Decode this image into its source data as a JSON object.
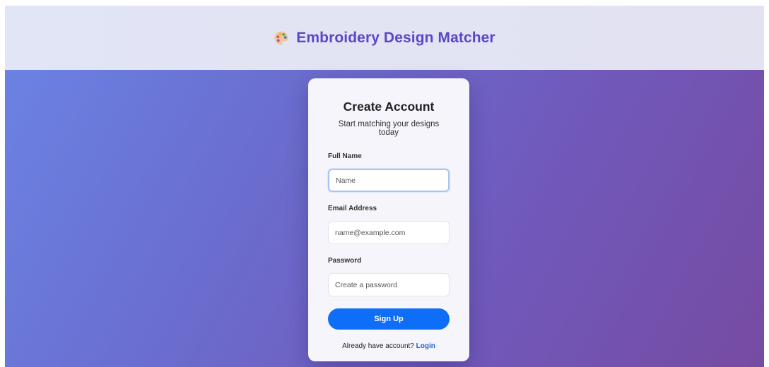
{
  "header": {
    "title": "Embroidery Design Matcher",
    "logo_icon": "artist-palette-icon",
    "title_color": "#5a47c8"
  },
  "card": {
    "title": "Create Account",
    "subtitle": "Start matching your designs today",
    "fields": {
      "full_name": {
        "label": "Full Name",
        "placeholder": "Name",
        "value": "",
        "focused": true
      },
      "email": {
        "label": "Email Address",
        "placeholder": "name@example.com",
        "value": ""
      },
      "password": {
        "label": "Password",
        "placeholder": "Create a password",
        "value": ""
      }
    },
    "submit_label": "Sign Up",
    "footer_text": "Already have account?",
    "login_label": "Login"
  },
  "colors": {
    "accent": "#0f6ef7",
    "link": "#1565d8",
    "gradient_start": "#6b82e3",
    "gradient_end": "#764ba2"
  }
}
